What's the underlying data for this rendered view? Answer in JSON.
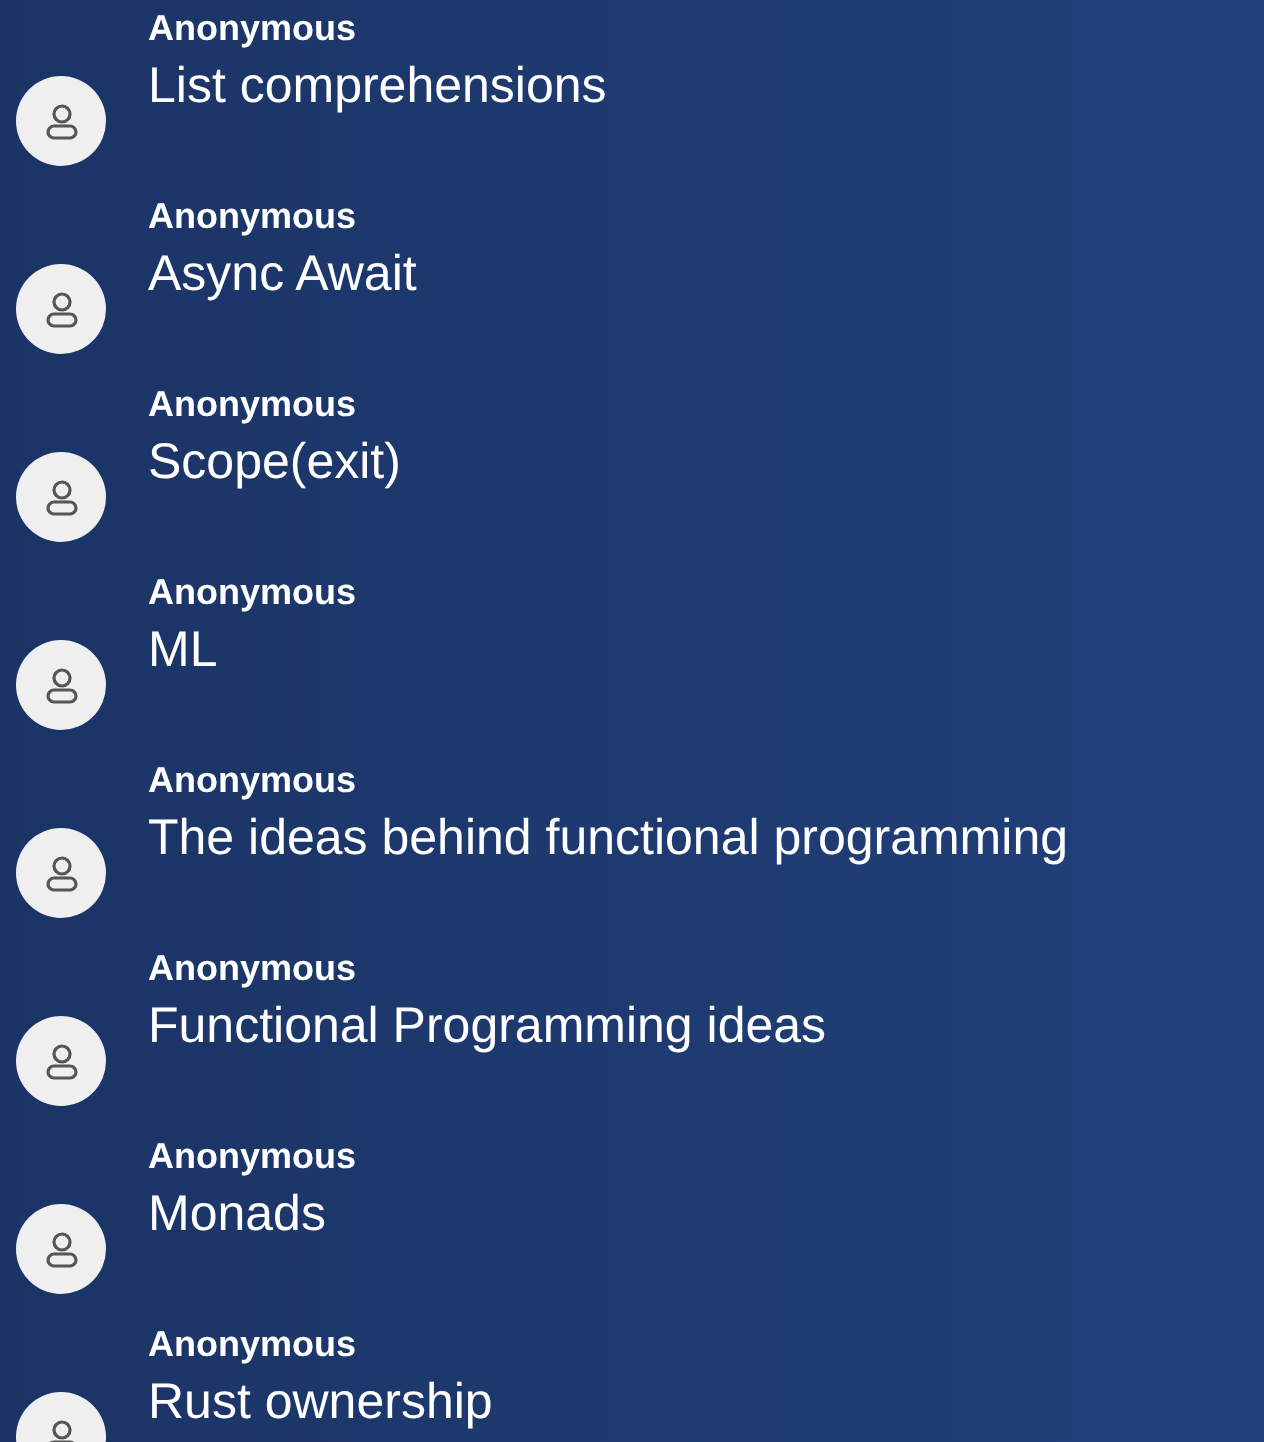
{
  "messages": [
    {
      "author": "Anonymous",
      "text": "List comprehensions"
    },
    {
      "author": "Anonymous",
      "text": "Async Await"
    },
    {
      "author": "Anonymous",
      "text": "Scope(exit)"
    },
    {
      "author": "Anonymous",
      "text": "ML"
    },
    {
      "author": "Anonymous",
      "text": "The ideas behind functional programming"
    },
    {
      "author": "Anonymous",
      "text": "Functional Programming ideas"
    },
    {
      "author": "Anonymous",
      "text": "Monads"
    },
    {
      "author": "Anonymous",
      "text": "Rust ownership"
    }
  ]
}
